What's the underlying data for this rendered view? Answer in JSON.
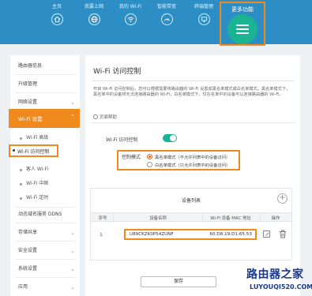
{
  "nav": {
    "items": [
      {
        "label": "主页",
        "icon": "home-icon"
      },
      {
        "label": "我要上网",
        "icon": "globe-icon"
      },
      {
        "label": "我的 Wi-Fi",
        "icon": "wifi-icon"
      },
      {
        "label": "智能带宽",
        "icon": "gauge-icon"
      },
      {
        "label": "终端管理",
        "icon": "devices-icon"
      }
    ],
    "more_label": "更多功能",
    "more_icon": "menu-icon",
    "accent": "#1ab394",
    "bar_color": "#2d8ec6",
    "highlight": "#f08a1d"
  },
  "sidebar": {
    "items": [
      "路由器信息",
      "升级管理",
      "网络设置"
    ],
    "active": "Wi-Fi 设置",
    "sub_items": [
      "Wi-Fi 高级",
      "Wi-Fi 访问控制",
      "客人 Wi-Fi",
      "Wi-Fi 中继",
      "Wi-Fi 定时"
    ],
    "lower_items": [
      "动态域名服务 DDNS",
      "存储共享",
      "安全设置",
      "系统设置",
      "应用"
    ]
  },
  "main": {
    "title": "Wi-Fi 访问控制",
    "description": "开启 Wi-Fi 访问控制后，您可以根据需要将路由器的 Wi-Fi 设置成黑名单模式或白名单模式。黑名单模式下，黑名单中的设备将无法连接路由器的 Wi-Fi；白名单模式下，仅在名单中的设备可以连接路由器的 Wi-Fi。",
    "help": "页面帮助",
    "control_label": "Wi-Fi 访问控制",
    "control_on": true,
    "mode_label": "控制模式",
    "modes": [
      "黑名单模式（不允许列表中的设备访问）",
      "白名单模式（只允许列表中的设备访问）"
    ],
    "selected_mode": 0,
    "table": {
      "title": "设备列表",
      "headers": [
        "序号",
        "设备名称",
        "Wi-Fi 设备 MAC 地址",
        "操作"
      ],
      "rows": [
        {
          "index": "1",
          "name": "U89CKZK0P54ZUNF",
          "mac": "60:D8:19:D1:65:53"
        }
      ]
    },
    "save_label": "保存"
  },
  "watermark": {
    "cn": "路由器之家",
    "en": "LUYOUQI520.COM"
  }
}
